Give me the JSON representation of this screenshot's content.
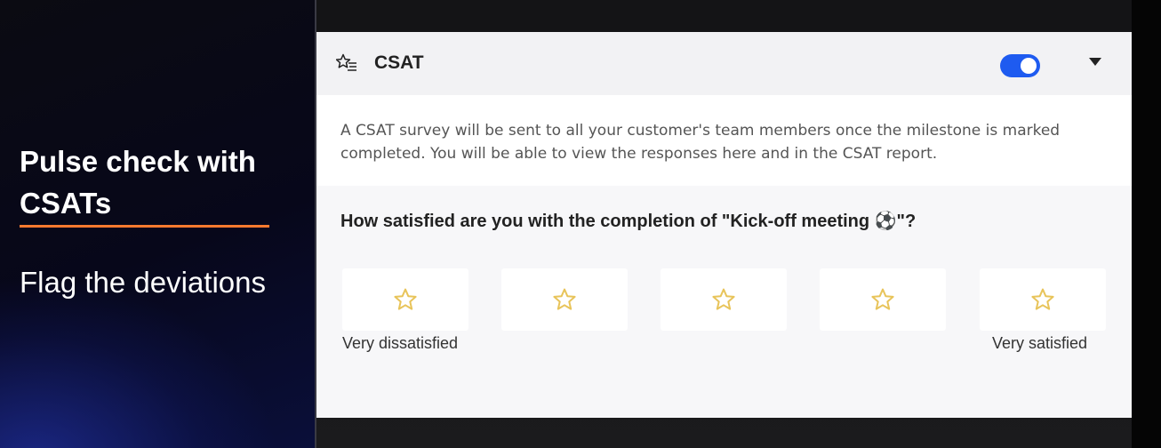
{
  "promo": {
    "title": "Pulse check with CSATs",
    "subtitle": "Flag the deviations",
    "accent_color": "#ff7a2f"
  },
  "card": {
    "header": {
      "icon": "star-list-icon",
      "title": "CSAT",
      "toggle_on": true,
      "toggle_color": "#1e5bf0",
      "collapse_icon": "caret-down-icon"
    },
    "description": "A CSAT survey will be sent to all your customer's team members once the milestone is marked completed. You will be able to view the responses here and in the CSAT report.",
    "question": "How satisfied are you with the completion of \"Kick-off meeting ⚽\"?",
    "rating": {
      "star_icon": "star-outline-icon",
      "star_color": "#e8c45a",
      "options": [
        1,
        2,
        3,
        4,
        5
      ],
      "min_label": "Very dissatisfied",
      "max_label": "Very satisfied"
    }
  }
}
